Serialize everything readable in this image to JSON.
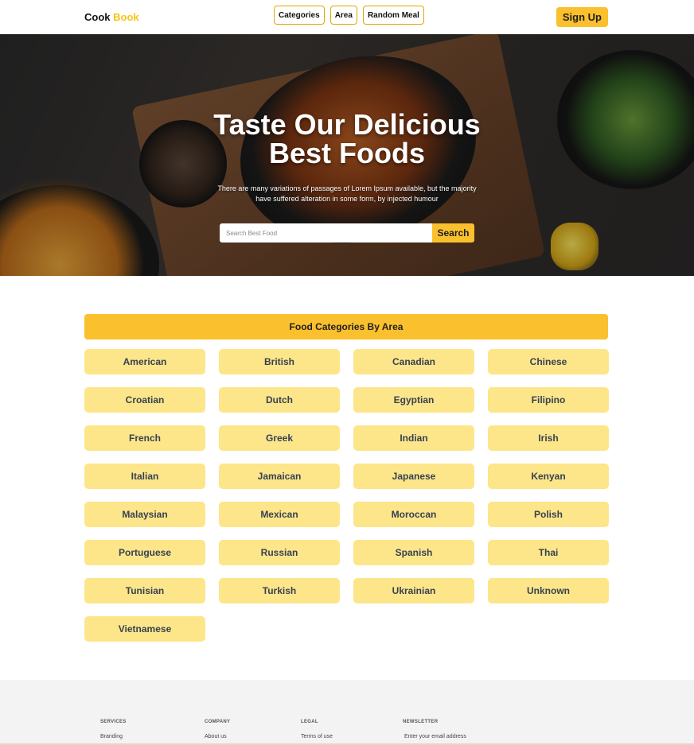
{
  "navbar": {
    "brand_main": "Cook",
    "brand_accent": "Book",
    "links": [
      "Categories",
      "Area",
      "Random Meal"
    ],
    "signup_label": "Sign Up"
  },
  "hero": {
    "title_line1": "Taste Our Delicious",
    "title_line2": "Best Foods",
    "subtitle": "There are many variations of passages of Lorem Ipsum available, but the majority have suffered alteration in some form, by injected humour",
    "search_placeholder": "Search Best Food",
    "search_button": "Search"
  },
  "area_section": {
    "title": "Food Categories By Area",
    "areas": [
      "American",
      "British",
      "Canadian",
      "Chinese",
      "Croatian",
      "Dutch",
      "Egyptian",
      "Filipino",
      "French",
      "Greek",
      "Indian",
      "Irish",
      "Italian",
      "Jamaican",
      "Japanese",
      "Kenyan",
      "Malaysian",
      "Mexican",
      "Moroccan",
      "Polish",
      "Portuguese",
      "Russian",
      "Spanish",
      "Thai",
      "Tunisian",
      "Turkish",
      "Ukrainian",
      "Unknown",
      "Vietnamese"
    ]
  },
  "footer": {
    "columns": [
      {
        "title": "SERVICES",
        "link": "Branding"
      },
      {
        "title": "COMPANY",
        "link": "About us"
      },
      {
        "title": "LEGAL",
        "link": "Terms of use"
      },
      {
        "title": "NEWSLETTER",
        "link": "Enter your email address"
      }
    ]
  },
  "colors": {
    "accent": "#fbc02d",
    "area_button": "#fde68a",
    "footer_bg": "#f3f3f3"
  }
}
